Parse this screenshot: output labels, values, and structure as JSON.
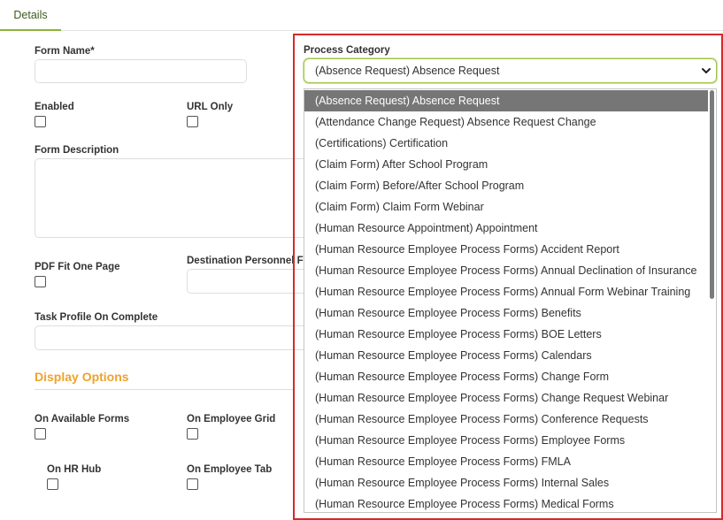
{
  "tabs": {
    "details": "Details"
  },
  "form": {
    "form_name_label": "Form Name*",
    "form_name_value": "",
    "enabled_label": "Enabled",
    "url_only_label": "URL Only",
    "form_description_label": "Form Description",
    "pdf_fit_label": "PDF Fit One Page",
    "destination_label": "Destination Personnel Fo",
    "task_profile_label": "Task Profile On Complete"
  },
  "display_options": {
    "title": "Display Options",
    "on_available_forms": "On Available Forms",
    "on_employee_grid": "On Employee Grid",
    "on_hr_hub": "On HR Hub",
    "on_employee_tab": "On Employee Tab"
  },
  "process_category": {
    "label": "Process Category",
    "selected": "(Absence Request) Absence Request",
    "options": [
      "(Absence Request) Absence Request",
      "(Attendance Change Request) Absence Request Change",
      "(Certifications) Certification",
      "(Claim Form) After School Program",
      "(Claim Form) Before/After School Program",
      "(Claim Form) Claim Form Webinar",
      "(Human Resource Appointment) Appointment",
      "(Human Resource Employee Process Forms) Accident Report",
      "(Human Resource Employee Process Forms) Annual Declination of Insurance",
      "(Human Resource Employee Process Forms) Annual Form Webinar Training",
      "(Human Resource Employee Process Forms) Benefits",
      "(Human Resource Employee Process Forms) BOE Letters",
      "(Human Resource Employee Process Forms) Calendars",
      "(Human Resource Employee Process Forms) Change Form",
      "(Human Resource Employee Process Forms) Change Request Webinar",
      "(Human Resource Employee Process Forms) Conference Requests",
      "(Human Resource Employee Process Forms) Employee Forms",
      "(Human Resource Employee Process Forms) FMLA",
      "(Human Resource Employee Process Forms) Internal Sales",
      "(Human Resource Employee Process Forms) Medical Forms"
    ]
  },
  "colors": {
    "accent_green": "#8cb33a",
    "section_orange": "#f0a12c",
    "highlight_red": "#d42a2a",
    "selected_option_bg": "#767676"
  }
}
